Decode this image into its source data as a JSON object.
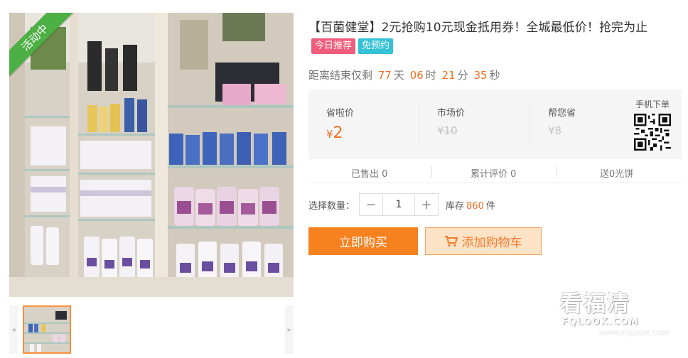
{
  "product": {
    "badge": "活动中",
    "title": "【百菌健堂】2元抢购10元现金抵用券！全城最低价！抢完为止",
    "tags": [
      {
        "label": "今日推荐",
        "color": "#f05c7b"
      },
      {
        "label": "免预约",
        "color": "#35c1d6"
      }
    ]
  },
  "countdown": {
    "prefix": "距离结束仅剩",
    "days": "77",
    "days_unit": "天",
    "hours": "06",
    "hours_unit": "时",
    "minutes": "21",
    "minutes_unit": "分",
    "seconds": "35",
    "seconds_unit": "秒"
  },
  "prices": {
    "save_label": "省啦价",
    "save_currency": "¥",
    "save_value": "2",
    "market_label": "市场价",
    "market_value": "¥10",
    "help_label": "帮您省",
    "help_value": "¥8",
    "qr_label": "手机下单"
  },
  "stats": {
    "sold": "已售出 0",
    "reviews": "累计评价 0",
    "gift": "送0光饼"
  },
  "quantity": {
    "label": "选择数量：",
    "minus": "−",
    "value": "1",
    "plus": "+",
    "stock_prefix": "库存",
    "stock_count": "860",
    "stock_unit": "件"
  },
  "actions": {
    "buy_label": "立即购买",
    "cart_label": "添加购物车"
  },
  "thumbs": {
    "prev": "◂",
    "next": "▸"
  },
  "watermark": {
    "big": "看福清",
    "small": "FQLOOK.COM",
    "url": "WWW.FQLOOK.COM"
  },
  "colors": {
    "accent": "#f16f22",
    "buy": "#f5811f",
    "cart_bg": "#ffe3c6",
    "badge": "#4cb045"
  }
}
